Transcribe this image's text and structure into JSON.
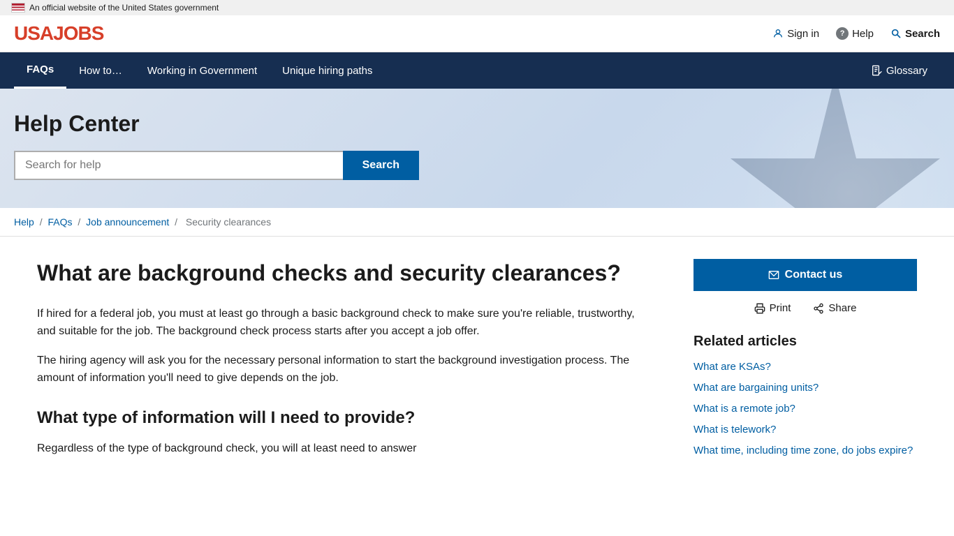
{
  "gov_banner": {
    "text": "An official website of the United States government"
  },
  "header": {
    "logo": "USAJOBS",
    "nav": {
      "signin": "Sign in",
      "help": "Help",
      "search": "Search"
    }
  },
  "main_nav": {
    "items": [
      {
        "label": "FAQs",
        "active": true
      },
      {
        "label": "How to…",
        "active": false
      },
      {
        "label": "Working in Government",
        "active": false
      },
      {
        "label": "Unique hiring paths",
        "active": false
      }
    ],
    "glossary": "Glossary"
  },
  "hero": {
    "title": "Help Center",
    "search_placeholder": "Search for help",
    "search_button": "Search"
  },
  "breadcrumb": {
    "items": [
      {
        "label": "Help",
        "href": "#"
      },
      {
        "label": "FAQs",
        "href": "#"
      },
      {
        "label": "Job announcement",
        "href": "#"
      },
      {
        "label": "Security clearances",
        "href": null
      }
    ]
  },
  "article": {
    "title": "What are background checks and security clearances?",
    "paragraphs": [
      "If hired for a federal job, you must at least go through a basic background check to make sure you're reliable, trustworthy, and suitable for the job. The background check process starts after you accept a job offer.",
      "The hiring agency will ask you for the necessary personal information to start the background investigation process. The amount of information you'll need to give depends on the job."
    ],
    "section_title": "What type of information will I need to provide?",
    "section_intro": "Regardless of the type of background check, you will at least need to answer"
  },
  "sidebar": {
    "contact_label": "Contact us",
    "print_label": "Print",
    "share_label": "Share",
    "related_title": "Related articles",
    "related_links": [
      "What are KSAs?",
      "What are bargaining units?",
      "What is a remote job?",
      "What is telework?",
      "What time, including time zone, do jobs expire?"
    ]
  }
}
